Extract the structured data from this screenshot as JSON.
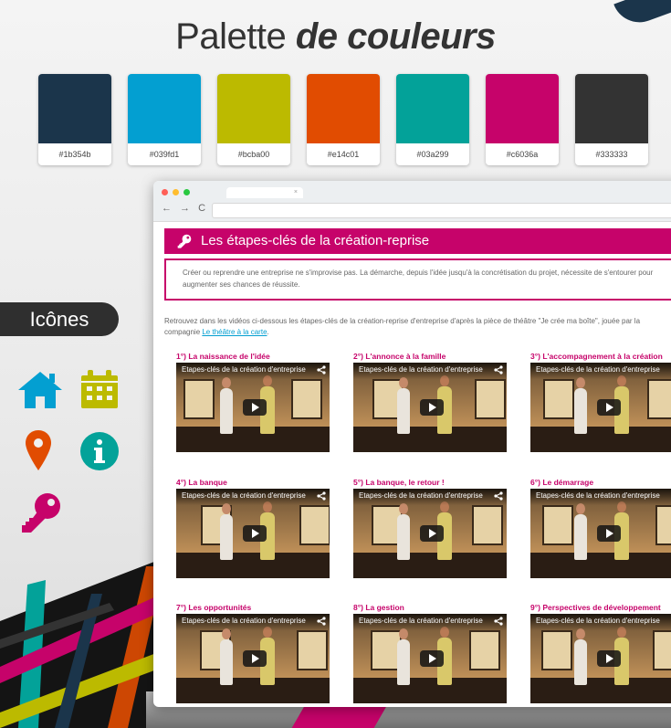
{
  "heading": {
    "light": "Palette",
    "bold": "de couleurs"
  },
  "palette": [
    {
      "hex": "#1b354b",
      "label": "#1b354b"
    },
    {
      "hex": "#039fd1",
      "label": "#039fd1"
    },
    {
      "hex": "#bcba00",
      "label": "#bcba00"
    },
    {
      "hex": "#e14c01",
      "label": "#e14c01"
    },
    {
      "hex": "#03a299",
      "label": "#03a299"
    },
    {
      "hex": "#c6036a",
      "label": "#c6036a"
    },
    {
      "hex": "#333333",
      "label": "#333333"
    }
  ],
  "icons_section": {
    "label": "Icônes",
    "icons": [
      {
        "name": "home-icon",
        "color": "#039fd1"
      },
      {
        "name": "calendar-icon",
        "color": "#bcba00"
      },
      {
        "name": "map-pin-icon",
        "color": "#e14c01"
      },
      {
        "name": "info-icon",
        "color": "#03a299"
      },
      {
        "name": "key-icon",
        "color": "#c6036a"
      }
    ]
  },
  "browser": {
    "tab_close": "×",
    "nav_glyphs": "← → C",
    "window_dots": [
      "#ff5f57",
      "#ffbd2e",
      "#28c840"
    ]
  },
  "page": {
    "banner_title": "Les étapes-clés de la création-reprise",
    "intro": "Créer ou reprendre une entreprise ne s'improvise pas. La démarche, depuis l'idée jusqu'à la concrétisation du projet, nécessite de s'entourer pour augmenter ses chances de réussite.",
    "paragraph": "Retrouvez dans les vidéos ci-dessous les étapes-clés de la création-reprise d'entreprise d'après la pièce de théâtre \"Je crée ma boîte\", jouée par la compagnie ",
    "link_text": "Le théâtre à la carte",
    "paragraph_end": ".",
    "video_caption": "Etapes-clés de la création d'entreprise",
    "videos": [
      {
        "title": "1°) La naissance de l'idée"
      },
      {
        "title": "2°) L'annonce à la famille"
      },
      {
        "title": "3°) L'accompagnement à la création"
      },
      {
        "title": "4°) La banque"
      },
      {
        "title": "5°) La banque, le retour !"
      },
      {
        "title": "6°) Le démarrage"
      },
      {
        "title": "7°) Les opportunités"
      },
      {
        "title": "8°) La gestion"
      },
      {
        "title": "9°) Perspectives de développement"
      }
    ]
  }
}
